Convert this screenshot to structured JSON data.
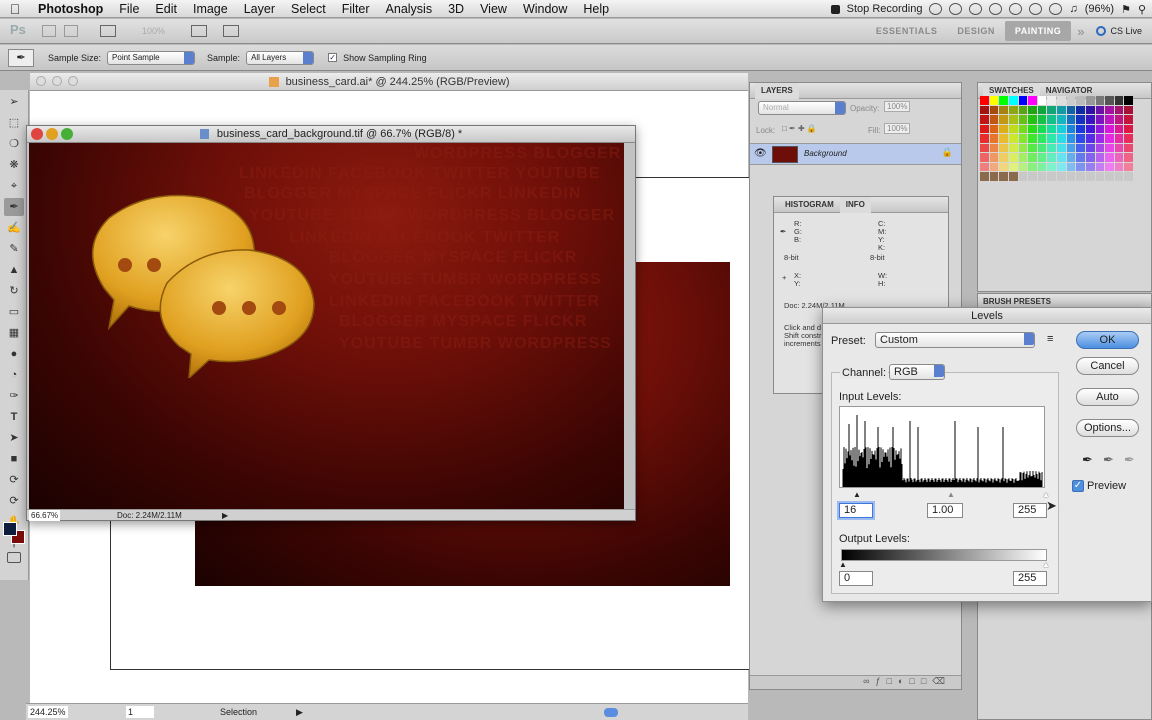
{
  "menubar": {
    "app_name": "Photoshop",
    "items": [
      "File",
      "Edit",
      "Image",
      "Layer",
      "Select",
      "Filter",
      "Analysis",
      "3D",
      "View",
      "Window",
      "Help"
    ],
    "stop_recording": "Stop Recording",
    "battery": "(96%)"
  },
  "appbar": {
    "zoom": "100%",
    "workspaces": [
      "ESSENTIALS",
      "DESIGN",
      "PAINTING"
    ],
    "cs_live": "CS Live"
  },
  "options": {
    "sample_size_label": "Sample Size:",
    "sample_size_value": "Point Sample",
    "sample_label": "Sample:",
    "sample_value": "All Layers",
    "show_ring_label": "Show Sampling Ring"
  },
  "document": {
    "title": "business_card.ai* @ 244.25% (RGB/Preview)",
    "zoom": "244.25%",
    "status": "Selection",
    "page": "1"
  },
  "inner_doc": {
    "title": "business_card_background.tif @ 66.7% (RGB/8) *",
    "zoom": "66.67%",
    "doc_size": "Doc: 2.24M/2.11M",
    "watermark_lines": [
      "WORDPRESS  BLOGGER",
      "LINKEDIN  FACEBOOK  TWITTER  YOUTUBE",
      "BLOGGER  MYSPACE  FLICKR  LINKEDIN",
      "YOUTUBE  TUMBR  WORDPRESS  BLOGGER",
      "LINKEDIN  FACEBOOK  TWITTER",
      "BLOGGER  MYSPACE  FLICKR",
      "YOUTUBE  TUMBR  WORDPRESS",
      "LINKEDIN  FACEBOOK  TWITTER",
      "BLOGGER  MYSPACE  FLICKR",
      "YOUTUBE  TUMBR  WORDPRESS"
    ]
  },
  "layers": {
    "tab": "LAYERS",
    "blend_mode": "Normal",
    "opacity_label": "Opacity:",
    "opacity": "100%",
    "lock_label": "Lock:",
    "fill_label": "Fill:",
    "fill": "100%",
    "layer_name": "Background"
  },
  "info": {
    "tabs": [
      "HISTOGRAM",
      "INFO"
    ],
    "rgb": [
      "R:",
      "G:",
      "B:"
    ],
    "cmyk": [
      "C:",
      "M:",
      "Y:",
      "K:"
    ],
    "bit_left": "8-bit",
    "bit_right": "8-bit",
    "xy": [
      "X:",
      "Y:"
    ],
    "wh": [
      "W:",
      "H:"
    ],
    "doc": "Doc: 2.24M/2.11M",
    "hint": [
      "Click and d",
      "Shift constr",
      "increments"
    ]
  },
  "swatches": {
    "tabs": [
      "SWATCHES",
      "NAVIGATOR"
    ],
    "brush_presets": "BRUSH PRESETS"
  },
  "levels": {
    "title": "Levels",
    "preset_label": "Preset:",
    "preset_value": "Custom",
    "channel_label": "Channel:",
    "channel_value": "RGB",
    "input_label": "Input Levels:",
    "input_black": "16",
    "input_gamma": "1.00",
    "input_white": "255",
    "output_label": "Output Levels:",
    "output_black": "0",
    "output_white": "255",
    "ok": "OK",
    "cancel": "Cancel",
    "auto": "Auto",
    "options": "Options...",
    "preview": "Preview"
  },
  "colors": {
    "doc_red": "#6d0f08",
    "bubble_gold": "#e0a020",
    "accent_blue": "#4d8fe0",
    "layer_selected": "#b8c9ec"
  }
}
